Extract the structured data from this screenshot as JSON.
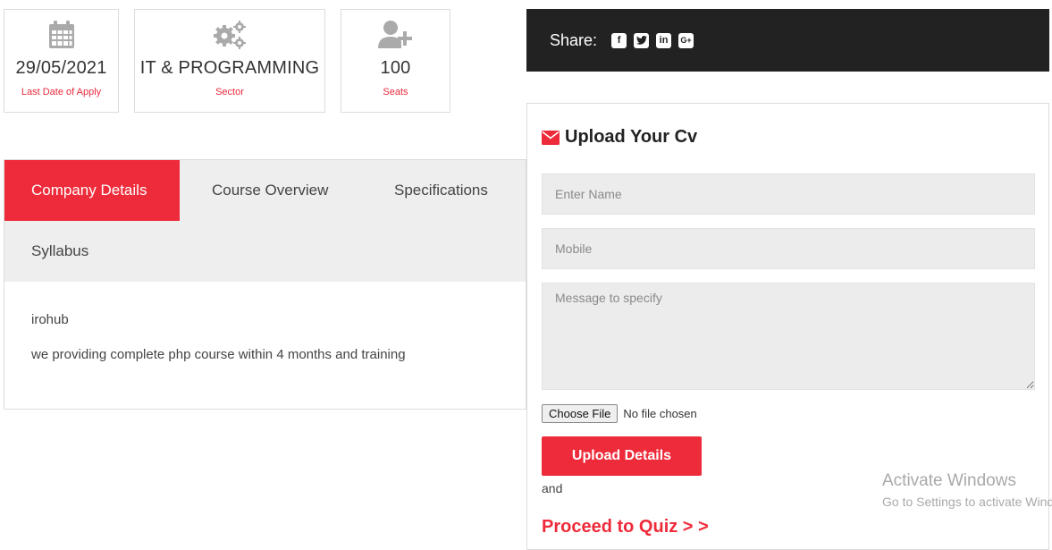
{
  "cards": [
    {
      "value": "29/05/2021",
      "label": "Last Date of Apply",
      "icon": "calendar-icon"
    },
    {
      "value": "IT & PROGRAMMING",
      "label": "Sector",
      "icon": "gears-icon"
    },
    {
      "value": "100",
      "label": "Seats",
      "icon": "user-plus-icon"
    }
  ],
  "tabs": [
    {
      "label": "Company Details",
      "active": true
    },
    {
      "label": "Course Overview",
      "active": false
    },
    {
      "label": "Specifications",
      "active": false
    },
    {
      "label": "Syllabus",
      "active": false
    }
  ],
  "content": {
    "company": "irohub",
    "description": "we providing complete php course within 4 months and training"
  },
  "share": {
    "label": "Share:",
    "icons": [
      "facebook-icon",
      "twitter-icon",
      "linkedin-icon",
      "google-plus-icon"
    ]
  },
  "upload": {
    "title": "Upload Your Cv",
    "name_placeholder": "Enter Name",
    "mobile_placeholder": "Mobile",
    "message_placeholder": "Message to specify",
    "file_button": "Choose File",
    "file_status": "No file chosen",
    "submit_label": "Upload Details",
    "and_text": "and",
    "quiz_link": "Proceed to Quiz > >"
  },
  "watermark": {
    "line1": "Activate Windows",
    "line2": "Go to Settings to activate Windows."
  },
  "colors": {
    "accent": "#ee2b3a",
    "share_bar": "#222222",
    "tab_bg": "#eeeeee",
    "field_bg": "#ececec"
  }
}
